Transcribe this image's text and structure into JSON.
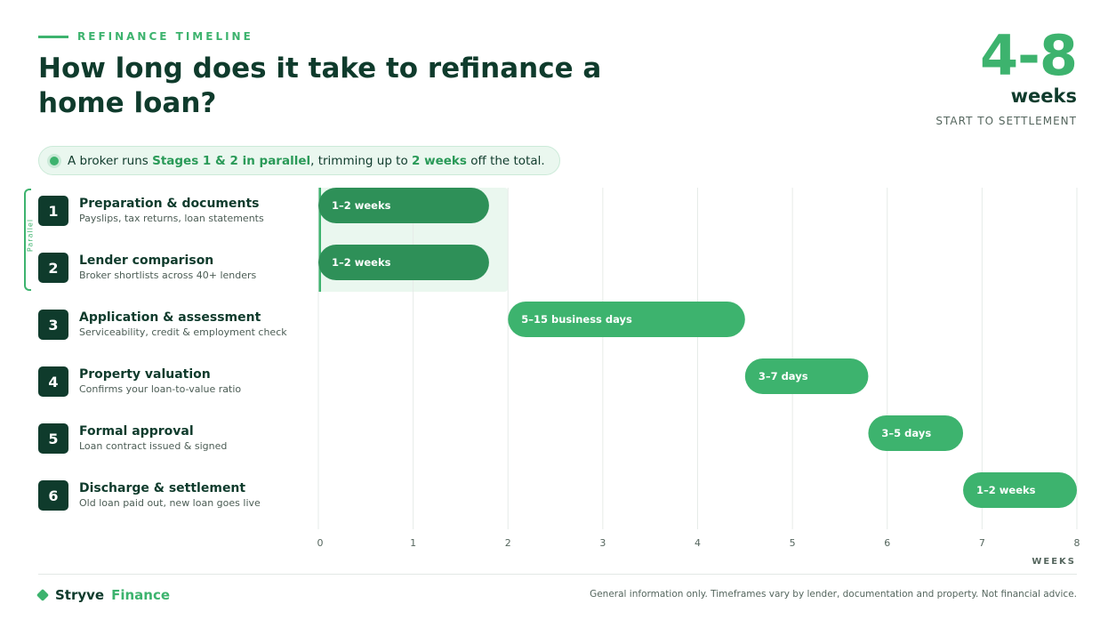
{
  "header": {
    "eyebrow": "REFINANCE TIMELINE",
    "title": "How long does it take to refinance a home loan?"
  },
  "stat": {
    "value": "4-8",
    "unit": "weeks",
    "caption": "START TO SETTLEMENT"
  },
  "callout": {
    "prefix": "A broker runs ",
    "highlight1": "Stages 1 & 2 in parallel",
    "middle": ", trimming up to ",
    "highlight2": "2 weeks",
    "suffix": " off the total."
  },
  "parallel_label": "Parallel",
  "stages": [
    {
      "number": "1",
      "name": "Preparation & documents",
      "desc": "Payslips, tax returns, loan statements"
    },
    {
      "number": "2",
      "name": "Lender comparison",
      "desc": "Broker shortlists across 40+ lenders"
    },
    {
      "number": "3",
      "name": "Application & assessment",
      "desc": "Serviceability, credit & employment check"
    },
    {
      "number": "4",
      "name": "Property valuation",
      "desc": "Confirms your loan-to-value ratio"
    },
    {
      "number": "5",
      "name": "Formal approval",
      "desc": "Loan contract issued & signed"
    },
    {
      "number": "6",
      "name": "Discharge & settlement",
      "desc": "Old loan paid out, new loan goes live"
    }
  ],
  "chart_data": {
    "type": "bar",
    "orientation": "horizontal-gantt",
    "xlabel": "WEEKS",
    "xlim": [
      0,
      8
    ],
    "xticks": [
      "0",
      "1",
      "2",
      "3",
      "4",
      "5",
      "6",
      "7",
      "8"
    ],
    "parallel_window": [
      0,
      2
    ],
    "bars": [
      {
        "stage": "1",
        "start": 0,
        "end": 1.8,
        "label": "1–2 weeks",
        "color": "#2e9058"
      },
      {
        "stage": "2",
        "start": 0,
        "end": 1.8,
        "label": "1–2 weeks",
        "color": "#2e9058"
      },
      {
        "stage": "3",
        "start": 2,
        "end": 4.5,
        "label": "5–15 business days",
        "color": "#3db36e"
      },
      {
        "stage": "4",
        "start": 4.5,
        "end": 5.8,
        "label": "3–7 days",
        "color": "#3db36e"
      },
      {
        "stage": "5",
        "start": 5.8,
        "end": 6.8,
        "label": "3–5 days",
        "color": "#3db36e"
      },
      {
        "stage": "6",
        "start": 6.8,
        "end": 8,
        "label": "1–2 weeks",
        "color": "#3db36e"
      }
    ],
    "grid": true
  },
  "brand": {
    "name_a": "Stryve",
    "name_b": "Finance"
  },
  "footnote": "General information only. Timeframes vary by lender, documentation and property. Not financial advice."
}
